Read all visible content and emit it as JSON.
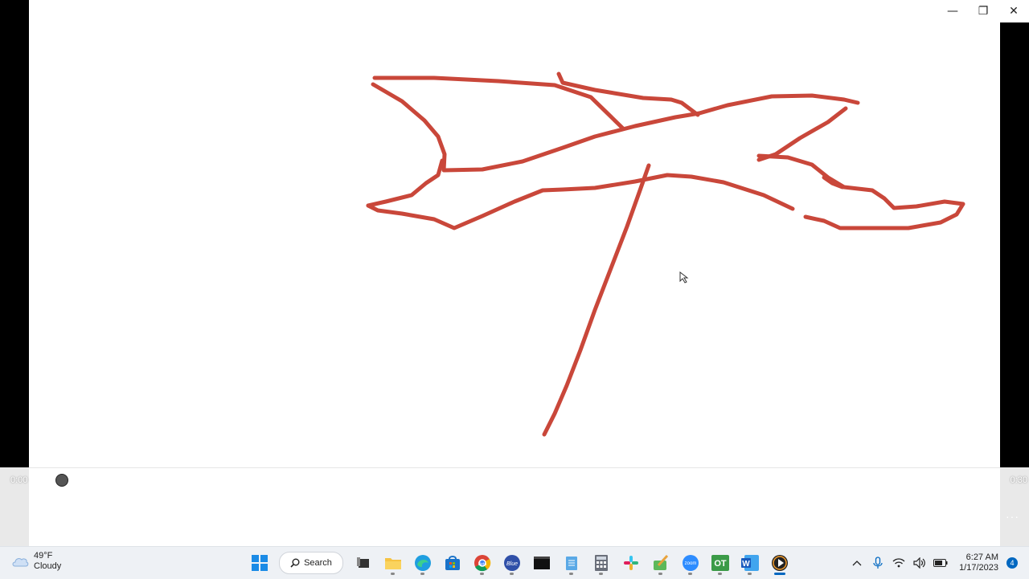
{
  "window": {
    "controls": {
      "minimize": "—",
      "restore": "❐",
      "close": "✕"
    }
  },
  "player": {
    "time_current": "0:00",
    "time_total": "0:30",
    "more": "···"
  },
  "taskbar": {
    "weather": {
      "temp": "49°F",
      "condition": "Cloudy"
    },
    "search_label": "Search",
    "apps": [
      "start",
      "search",
      "task-view",
      "file-explorer",
      "edge",
      "store",
      "chrome-beta",
      "blue",
      "terminal",
      "notepad",
      "calculator",
      "slack",
      "paint",
      "zoom",
      "otter",
      "word",
      "media-player"
    ],
    "chrome_badge": "Beta",
    "blue_label": "Blue",
    "zoom_label": "zoom",
    "otter_label": "OT",
    "word_label": "W",
    "clock": {
      "time": "6:27 AM",
      "date": "1/17/2023"
    },
    "notification_count": "4"
  },
  "colors": {
    "stroke": "#c9473a",
    "taskbar_bg": "#eef1f5",
    "accent": "#0067c0"
  }
}
